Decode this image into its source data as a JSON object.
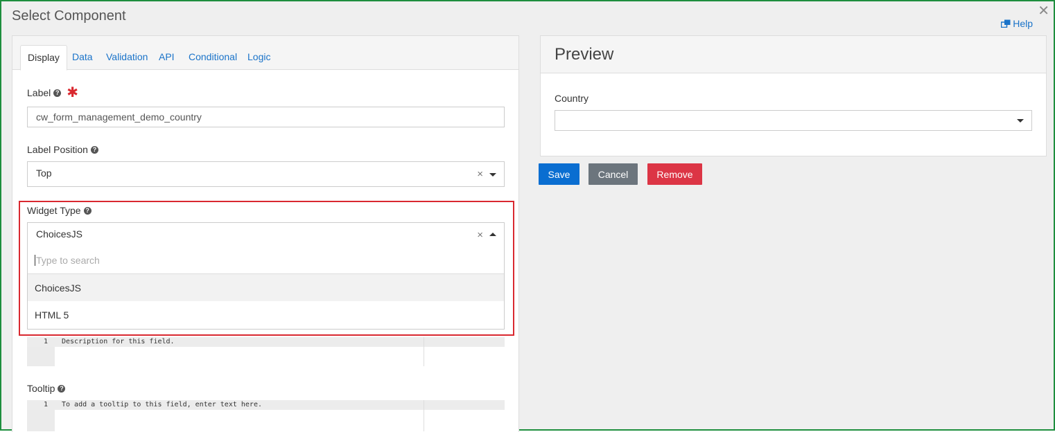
{
  "modal": {
    "title": "Select Component",
    "help_label": "Help",
    "close_glyph": "✕"
  },
  "tabs": [
    {
      "label": "Display",
      "active": true
    },
    {
      "label": "Data",
      "active": false
    },
    {
      "label": "Validation",
      "active": false
    },
    {
      "label": "API",
      "active": false
    },
    {
      "label": "Conditional",
      "active": false
    },
    {
      "label": "Logic",
      "active": false
    }
  ],
  "fields": {
    "label": {
      "label": "Label",
      "value": "cw_form_management_demo_country",
      "required_glyph": "✱"
    },
    "label_position": {
      "label": "Label Position",
      "value": "Top"
    },
    "widget_type": {
      "label": "Widget Type",
      "value": "ChoicesJS",
      "search_placeholder": "Type to search",
      "options": [
        "ChoicesJS",
        "HTML 5"
      ]
    },
    "description": {
      "line_number": "1",
      "text": "Description for this field."
    },
    "tooltip": {
      "label": "Tooltip",
      "line_number": "1",
      "text": "To add a tooltip to this field, enter text here."
    }
  },
  "preview": {
    "title": "Preview",
    "field_label": "Country",
    "field_value": ""
  },
  "actions": {
    "save": "Save",
    "cancel": "Cancel",
    "remove": "Remove"
  },
  "glyphs": {
    "help_icon": "?",
    "clear": "×"
  },
  "colors": {
    "link": "#1a73c9",
    "save": "#0a6ed1",
    "cancel": "#6c757d",
    "remove": "#dc3545",
    "highlight": "#d9282f",
    "frame": "#1e8e3e"
  }
}
